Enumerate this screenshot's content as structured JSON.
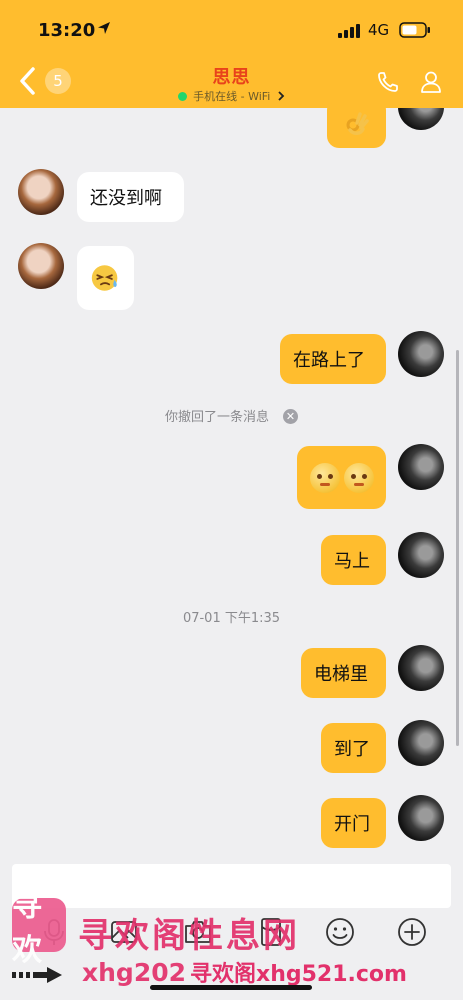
{
  "status_bar": {
    "time": "13:20",
    "network": "4G"
  },
  "header": {
    "back_icon": "chevron-left-icon",
    "unread_count": "5",
    "contact_name": "思思",
    "presence_text": "手机在线 - WiFi",
    "presence_color": "#22d66c",
    "accent": "#ffbd2e",
    "name_color": "#e8431b"
  },
  "messages": [
    {
      "from": "me",
      "content": "ok-hand-emoji"
    },
    {
      "from": "contact",
      "text": "还没到啊"
    },
    {
      "from": "contact",
      "content": "sweat-face-emoji"
    },
    {
      "from": "me",
      "text": "在路上了"
    },
    {
      "system": "你撤回了一条消息"
    },
    {
      "from": "me",
      "content": "two-pleading-face-emoji"
    },
    {
      "from": "me",
      "text": "马上"
    },
    {
      "timestamp": "07-01 下午1:35"
    },
    {
      "from": "me",
      "text": "电梯里"
    },
    {
      "from": "me",
      "text": "到了"
    },
    {
      "from": "me",
      "text": "开门"
    }
  ],
  "input_toolbar": {
    "icons": [
      "mic-icon",
      "image-icon",
      "camera-icon",
      "red-packet-icon",
      "emoji-icon",
      "plus-icon"
    ]
  },
  "watermark": {
    "logo_text": "寻欢",
    "line1": "寻欢阁性息网",
    "line2": "xhg202",
    "line3": "寻欢阁xhg521.com",
    "color": "#e2316b"
  }
}
